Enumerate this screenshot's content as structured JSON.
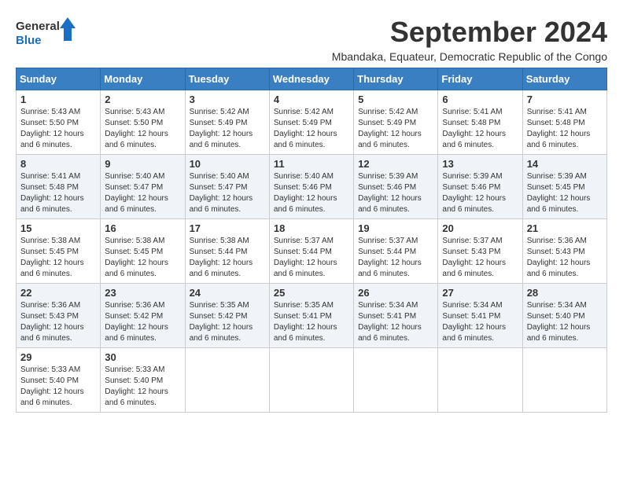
{
  "logo": {
    "line1": "General",
    "line2": "Blue"
  },
  "header": {
    "month_year": "September 2024",
    "subtitle": "Mbandaka, Equateur, Democratic Republic of the Congo"
  },
  "weekdays": [
    "Sunday",
    "Monday",
    "Tuesday",
    "Wednesday",
    "Thursday",
    "Friday",
    "Saturday"
  ],
  "weeks": [
    [
      {
        "day": "1",
        "sunrise": "5:43 AM",
        "sunset": "5:50 PM",
        "daylight": "12 hours and 6 minutes."
      },
      {
        "day": "2",
        "sunrise": "5:43 AM",
        "sunset": "5:50 PM",
        "daylight": "12 hours and 6 minutes."
      },
      {
        "day": "3",
        "sunrise": "5:42 AM",
        "sunset": "5:49 PM",
        "daylight": "12 hours and 6 minutes."
      },
      {
        "day": "4",
        "sunrise": "5:42 AM",
        "sunset": "5:49 PM",
        "daylight": "12 hours and 6 minutes."
      },
      {
        "day": "5",
        "sunrise": "5:42 AM",
        "sunset": "5:49 PM",
        "daylight": "12 hours and 6 minutes."
      },
      {
        "day": "6",
        "sunrise": "5:41 AM",
        "sunset": "5:48 PM",
        "daylight": "12 hours and 6 minutes."
      },
      {
        "day": "7",
        "sunrise": "5:41 AM",
        "sunset": "5:48 PM",
        "daylight": "12 hours and 6 minutes."
      }
    ],
    [
      {
        "day": "8",
        "sunrise": "5:41 AM",
        "sunset": "5:48 PM",
        "daylight": "12 hours and 6 minutes."
      },
      {
        "day": "9",
        "sunrise": "5:40 AM",
        "sunset": "5:47 PM",
        "daylight": "12 hours and 6 minutes."
      },
      {
        "day": "10",
        "sunrise": "5:40 AM",
        "sunset": "5:47 PM",
        "daylight": "12 hours and 6 minutes."
      },
      {
        "day": "11",
        "sunrise": "5:40 AM",
        "sunset": "5:46 PM",
        "daylight": "12 hours and 6 minutes."
      },
      {
        "day": "12",
        "sunrise": "5:39 AM",
        "sunset": "5:46 PM",
        "daylight": "12 hours and 6 minutes."
      },
      {
        "day": "13",
        "sunrise": "5:39 AM",
        "sunset": "5:46 PM",
        "daylight": "12 hours and 6 minutes."
      },
      {
        "day": "14",
        "sunrise": "5:39 AM",
        "sunset": "5:45 PM",
        "daylight": "12 hours and 6 minutes."
      }
    ],
    [
      {
        "day": "15",
        "sunrise": "5:38 AM",
        "sunset": "5:45 PM",
        "daylight": "12 hours and 6 minutes."
      },
      {
        "day": "16",
        "sunrise": "5:38 AM",
        "sunset": "5:45 PM",
        "daylight": "12 hours and 6 minutes."
      },
      {
        "day": "17",
        "sunrise": "5:38 AM",
        "sunset": "5:44 PM",
        "daylight": "12 hours and 6 minutes."
      },
      {
        "day": "18",
        "sunrise": "5:37 AM",
        "sunset": "5:44 PM",
        "daylight": "12 hours and 6 minutes."
      },
      {
        "day": "19",
        "sunrise": "5:37 AM",
        "sunset": "5:44 PM",
        "daylight": "12 hours and 6 minutes."
      },
      {
        "day": "20",
        "sunrise": "5:37 AM",
        "sunset": "5:43 PM",
        "daylight": "12 hours and 6 minutes."
      },
      {
        "day": "21",
        "sunrise": "5:36 AM",
        "sunset": "5:43 PM",
        "daylight": "12 hours and 6 minutes."
      }
    ],
    [
      {
        "day": "22",
        "sunrise": "5:36 AM",
        "sunset": "5:43 PM",
        "daylight": "12 hours and 6 minutes."
      },
      {
        "day": "23",
        "sunrise": "5:36 AM",
        "sunset": "5:42 PM",
        "daylight": "12 hours and 6 minutes."
      },
      {
        "day": "24",
        "sunrise": "5:35 AM",
        "sunset": "5:42 PM",
        "daylight": "12 hours and 6 minutes."
      },
      {
        "day": "25",
        "sunrise": "5:35 AM",
        "sunset": "5:41 PM",
        "daylight": "12 hours and 6 minutes."
      },
      {
        "day": "26",
        "sunrise": "5:34 AM",
        "sunset": "5:41 PM",
        "daylight": "12 hours and 6 minutes."
      },
      {
        "day": "27",
        "sunrise": "5:34 AM",
        "sunset": "5:41 PM",
        "daylight": "12 hours and 6 minutes."
      },
      {
        "day": "28",
        "sunrise": "5:34 AM",
        "sunset": "5:40 PM",
        "daylight": "12 hours and 6 minutes."
      }
    ],
    [
      {
        "day": "29",
        "sunrise": "5:33 AM",
        "sunset": "5:40 PM",
        "daylight": "12 hours and 6 minutes."
      },
      {
        "day": "30",
        "sunrise": "5:33 AM",
        "sunset": "5:40 PM",
        "daylight": "12 hours and 6 minutes."
      },
      null,
      null,
      null,
      null,
      null
    ]
  ],
  "labels": {
    "sunrise_prefix": "Sunrise: ",
    "sunset_prefix": "Sunset: ",
    "daylight_prefix": "Daylight: "
  }
}
